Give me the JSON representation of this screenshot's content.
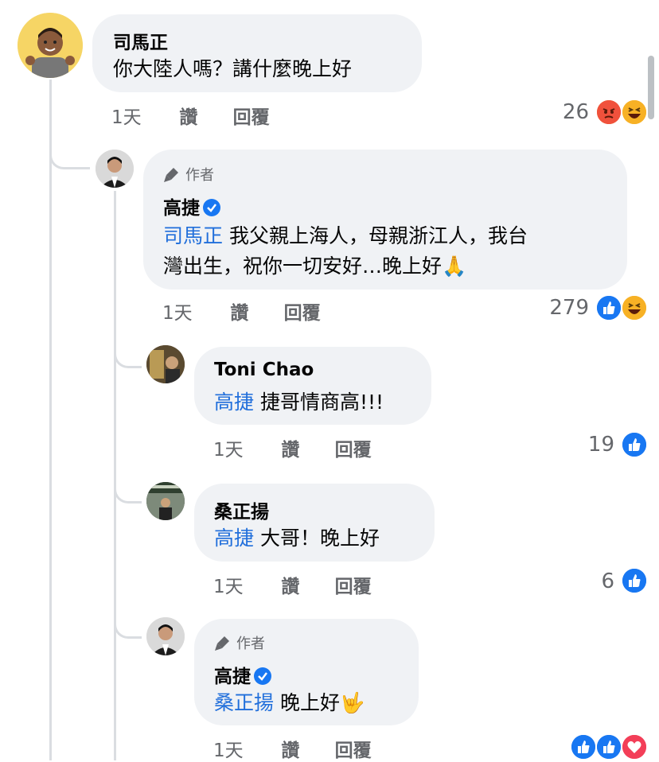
{
  "colors": {
    "accent": "#216fdb",
    "meta": "#65676b",
    "bubble": "#f0f2f5"
  },
  "comment": {
    "author": "司馬正",
    "text": "你大陸人嗎？講什麼晚上好",
    "time": "1天",
    "like_label": "讚",
    "reply_label": "回覆",
    "reaction_count": "26",
    "reactions": [
      "angry-icon",
      "haha-icon"
    ]
  },
  "replies": [
    {
      "badge": "作者",
      "author": "高捷",
      "mention": "司馬正",
      "text_line1": " 我父親上海人，母親浙江人，我台",
      "text_line2": "灣出生，祝你一切安好…晚上好",
      "emoji": "🙏",
      "time": "1天",
      "like_label": "讚",
      "reply_label": "回覆",
      "reaction_count": "279",
      "reactions": [
        "like-icon",
        "haha-icon"
      ]
    },
    {
      "author": "Toni Chao",
      "mention": "高捷",
      "text": " 捷哥情商高!!!",
      "time": "1天",
      "like_label": "讚",
      "reply_label": "回覆",
      "reaction_count": "19",
      "reactions": [
        "like-icon"
      ]
    },
    {
      "author": "桑正揚",
      "mention": "高捷",
      "text": " 大哥！晚上好",
      "time": "1天",
      "like_label": "讚",
      "reply_label": "回覆",
      "reaction_count": "6",
      "reactions": [
        "like-icon"
      ]
    },
    {
      "badge": "作者",
      "author": "高捷",
      "mention": "桑正揚",
      "text": " 晚上好",
      "emoji": "🤟",
      "time": "1天",
      "like_label": "讚",
      "reply_label": "回覆",
      "reactions": [
        "like-icon",
        "like-icon",
        "love-icon"
      ]
    }
  ]
}
